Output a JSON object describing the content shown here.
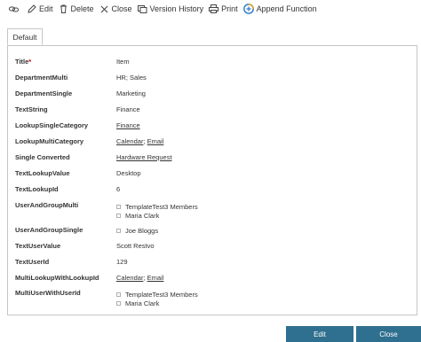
{
  "toolbar": {
    "items": [
      {
        "label": "",
        "icon": "link-icon"
      },
      {
        "label": "Edit",
        "icon": "pencil-icon"
      },
      {
        "label": "Delete",
        "icon": "trash-icon"
      },
      {
        "label": "Close",
        "icon": "close-icon"
      },
      {
        "label": "Version History",
        "icon": "history-icon"
      },
      {
        "label": "Print",
        "icon": "printer-icon"
      },
      {
        "label": "Append Function",
        "icon": "append-function-icon"
      }
    ]
  },
  "tabs": [
    {
      "label": "Default"
    }
  ],
  "fields": {
    "title": {
      "label": "Title",
      "required_mark": "*",
      "value": "Item"
    },
    "department_multi": {
      "label": "DepartmentMulti",
      "value": "HR; Sales"
    },
    "department_single": {
      "label": "DepartmentSingle",
      "value": "Marketing"
    },
    "text_string": {
      "label": "TextString",
      "value": "Finance"
    },
    "lookup_single_category": {
      "label": "LookupSingleCategory",
      "value": "Finance"
    },
    "lookup_multi_category": {
      "label": "LookupMultiCategory",
      "value1": "Calendar",
      "separator": "; ",
      "value2": "Email"
    },
    "single_converted": {
      "label": "Single Converted",
      "value": "Hardware Request"
    },
    "text_lookup_value": {
      "label": "TextLookupValue",
      "value": "Desktop"
    },
    "text_lookup_id": {
      "label": "TextLookupId",
      "value": "6"
    },
    "user_and_group_multi": {
      "label": "UserAndGroupMulti",
      "people": [
        "TemplateTest3 Members",
        "Maria Clark"
      ]
    },
    "user_and_group_single": {
      "label": "UserAndGroupSingle",
      "people": [
        "Joe Bloggs"
      ]
    },
    "text_user_value": {
      "label": "TextUserValue",
      "value": "Scott Restvo"
    },
    "text_user_id": {
      "label": "TextUserId",
      "value": "129"
    },
    "multi_lookup_with_lookup_id": {
      "label": "MultiLookupWithLookupId",
      "value1": "Calendar",
      "separator": "; ",
      "value2": "Email"
    },
    "multi_user_with_user_id": {
      "label": "MultiUserWithUserId",
      "people": [
        "TemplateTest3 Members",
        "Maria Clark"
      ]
    }
  },
  "footer": {
    "edit_label": "Edit",
    "close_label": "Close"
  },
  "colors": {
    "footer_button": "#2f6f8f",
    "required": "#c00000",
    "border": "#c6c6c6"
  }
}
